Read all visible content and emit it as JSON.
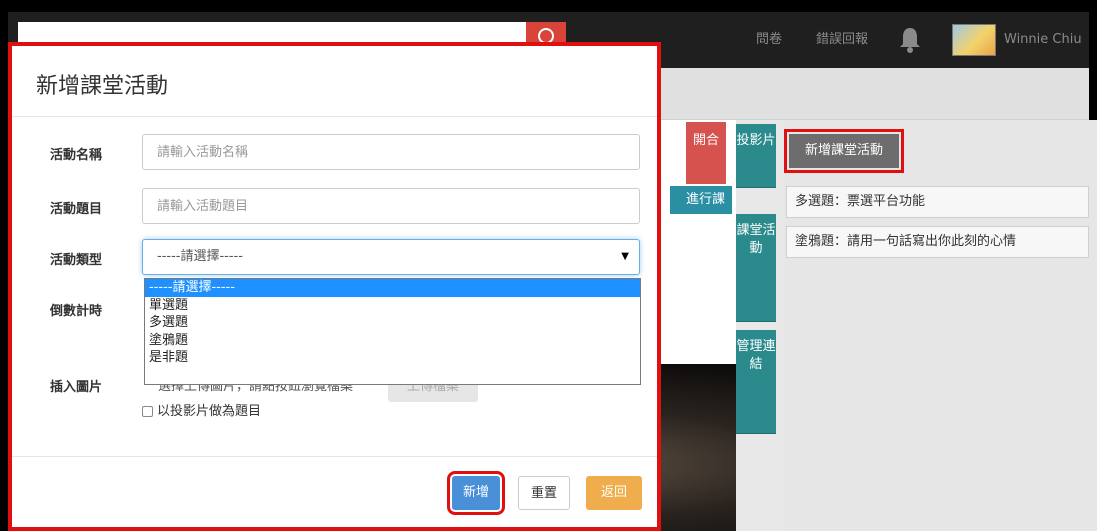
{
  "navbar": {
    "survey": "問卷",
    "report_error": "錯誤回報",
    "user_name": "Winnie Chiu"
  },
  "side_buttons": {
    "open": "開合",
    "start": "進行課"
  },
  "vertical_tabs": {
    "slides": "投影片",
    "class_activity": "課堂活動",
    "manage_links": "管理連結"
  },
  "right_panel": {
    "new_activity_button": "新增課堂活動",
    "activities": [
      "多選題：票選平台功能",
      "塗鴉題：請用一句話寫出你此刻的心情"
    ]
  },
  "modal": {
    "title": "新增課堂活動",
    "fields": {
      "name_label": "活動名稱",
      "name_placeholder": "請輸入活動名稱",
      "topic_label": "活動題目",
      "topic_placeholder": "請輸入活動題目",
      "type_label": "活動類型",
      "type_selected": "-----請選擇-----",
      "countdown_label": "倒數計時",
      "image_label": "插入圖片",
      "file_hint": "選擇上傳圖片，請點按鈕瀏覽檔案",
      "upload_button": "上傳檔案",
      "use_slide_label": "以投影片做為題目"
    },
    "type_options": [
      "-----請選擇-----",
      "單選題",
      "多選題",
      "塗鴉題",
      "是非題"
    ],
    "buttons": {
      "add": "新增",
      "reset": "重置",
      "back": "返回"
    }
  }
}
